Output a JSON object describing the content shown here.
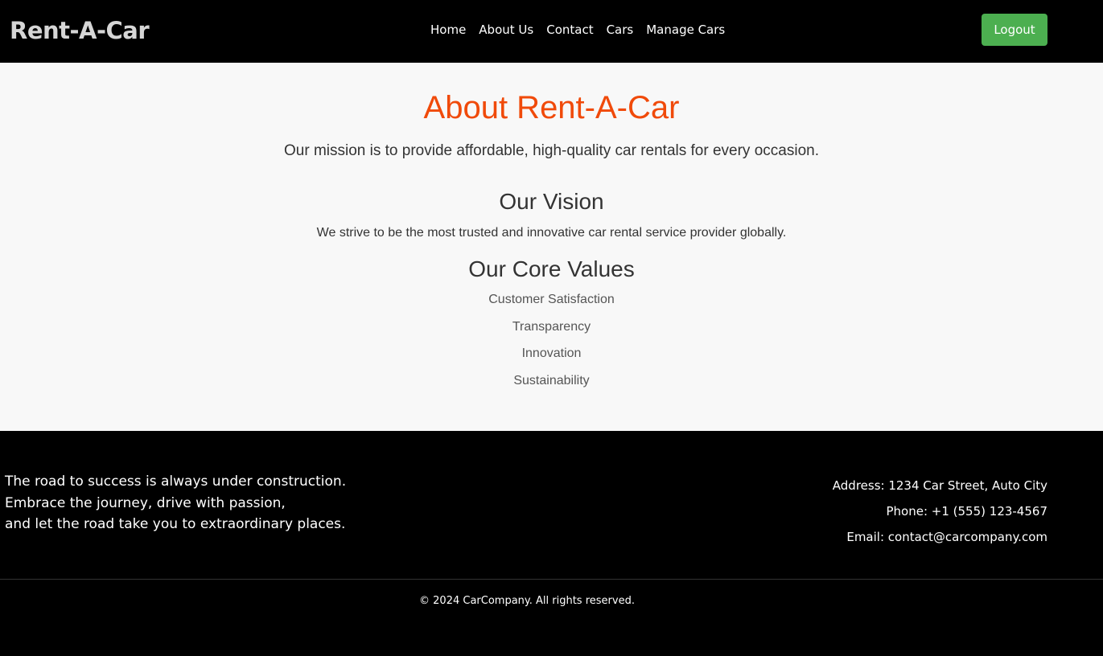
{
  "header": {
    "brand": "Rent-A-Car",
    "nav": [
      "Home",
      "About Us",
      "Contact",
      "Cars",
      "Manage Cars"
    ],
    "logout_label": "Logout"
  },
  "main": {
    "title": "About Rent-A-Car",
    "mission": "Our mission is to provide affordable, high-quality car rentals for every occasion.",
    "vision_heading": "Our Vision",
    "vision_text": "We strive to be the most trusted and innovative car rental service provider globally.",
    "values_heading": "Our Core Values",
    "values": [
      "Customer Satisfaction",
      "Transparency",
      "Innovation",
      "Sustainability"
    ]
  },
  "footer": {
    "quote_lines": [
      "The road to success is always under construction.",
      "Embrace the journey, drive with passion,",
      "and let the road take you to extraordinary places."
    ],
    "address": "Address: 1234 Car Street, Auto City",
    "phone": "Phone: +1 (555) 123-4567",
    "email": "Email: contact@carcompany.com",
    "copyright": "© 2024 CarCompany. All rights reserved."
  },
  "colors": {
    "accent": "#f04a0a",
    "logout_button": "#4caf50",
    "header_bg": "#000000",
    "main_bg": "#f8f8f8"
  }
}
